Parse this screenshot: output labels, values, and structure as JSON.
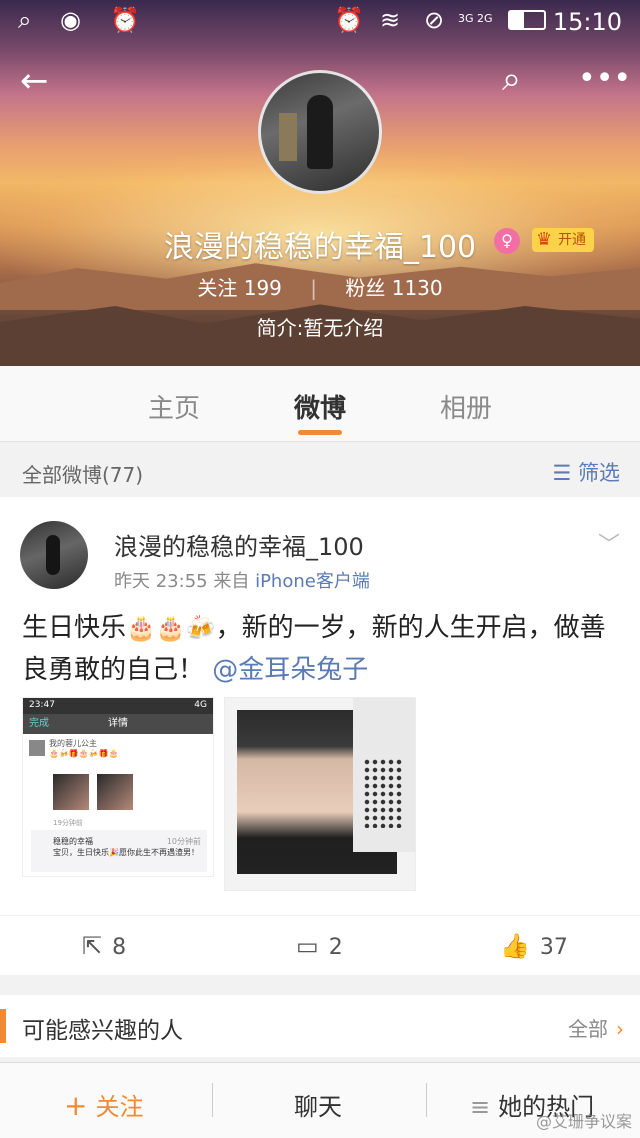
{
  "status_bar": {
    "time": "15:10",
    "signal": "3G 2G"
  },
  "profile": {
    "username": "浪漫的稳稳的幸福_100",
    "vip_label": "开通",
    "following_label": "关注",
    "following_count": "199",
    "fans_label": "粉丝",
    "fans_count": "1130",
    "bio": "简介:暂无介绍"
  },
  "tabs": [
    {
      "label": "主页"
    },
    {
      "label": "微博"
    },
    {
      "label": "相册"
    }
  ],
  "filter": {
    "title": "全部微博(77)",
    "button": "筛选"
  },
  "post": {
    "author": "浪漫的稳稳的幸福_100",
    "time": "昨天 23:55",
    "from_label": "来自",
    "source": "iPhone客户端",
    "text_part1": "生日快乐",
    "text_part2": "，新的一岁，新的人生开启，做善良勇敢的自己！",
    "mention": "@金耳朵兔子",
    "shot": {
      "time": "23:47",
      "net": "4G",
      "nav_done": "完成",
      "nav_title": "详情",
      "line1": "我的蓉儿公主",
      "ago": "19分钟前",
      "reply_name": "稳稳的幸福",
      "reply_ago": "10分钟前",
      "reply_text": "宝贝，生日快乐🎉愿你此生不再遇渣男！"
    },
    "reposts": "8",
    "comments": "2",
    "likes": "37"
  },
  "suggest": {
    "title": "可能感兴趣的人",
    "all_label": "全部"
  },
  "bottom_bar": {
    "follow": "关注",
    "chat": "聊天",
    "hot": "她的热门"
  },
  "watermark": "@艾珊争议案"
}
